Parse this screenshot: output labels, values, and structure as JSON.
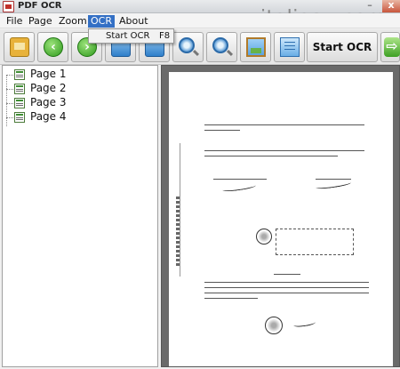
{
  "window": {
    "title": "PDF OCR",
    "watermark": "www.italiasw.com",
    "minimize_glyph": "–",
    "close_glyph": "x"
  },
  "menu": {
    "file": "File",
    "page": "Page",
    "zoom": "Zoom",
    "ocr": "OCR",
    "about": "About"
  },
  "ocr_dropdown": {
    "start_ocr_label": "Start OCR",
    "start_ocr_shortcut": "F8"
  },
  "toolbar": {
    "buttons": [
      {
        "name": "open-icon"
      },
      {
        "name": "back-arrow-icon",
        "glyph": "‹"
      },
      {
        "name": "forward-arrow-icon",
        "glyph": "›"
      },
      {
        "name": "page-blue-icon"
      },
      {
        "name": "page-blue-2-icon"
      },
      {
        "name": "zoom-in-icon"
      },
      {
        "name": "zoom-out-icon"
      },
      {
        "name": "picture-icon"
      },
      {
        "name": "grid-icon"
      },
      {
        "name": "next-arrow-icon",
        "glyph": "⇨"
      }
    ],
    "start_ocr_label": "Start OCR"
  },
  "tree": {
    "pages": [
      "Page 1",
      "Page 2",
      "Page 3",
      "Page 4"
    ]
  },
  "colors": {
    "menu_highlight": "#3470c5",
    "viewer_bg": "#6a6a6a"
  }
}
